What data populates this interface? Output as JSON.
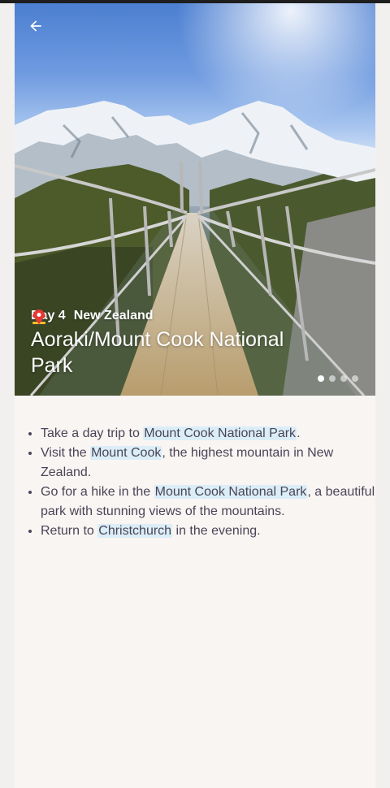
{
  "app": {
    "back_icon": "arrow-back-icon",
    "hero": {
      "day_emoji_icon": "beach-umbrella-icon",
      "day_label": "Day 4",
      "location_emoji_icon": "map-pin-icon",
      "location": "New Zealand",
      "title": "Aoraki/Mount Cook National Park",
      "image_icon": "mountain-bridge-photo",
      "carousel": {
        "count": 4,
        "active_index": 0
      }
    },
    "itinerary": [
      {
        "before": "Take a day trip to ",
        "link": "Mount Cook National Park",
        "after": "."
      },
      {
        "before": "Visit the ",
        "link": "Mount Cook",
        "after": ", the highest mountain in New Zealand."
      },
      {
        "before": "Go for a hike in the ",
        "link": "Mount Cook National Park",
        "after": ", a beautiful park with stunning views of the mountains."
      },
      {
        "before": "Return to ",
        "link": "Christchurch",
        "after": " in the evening."
      }
    ],
    "colors": {
      "highlight": "#dbeef7",
      "text": "#4a4458",
      "card_bg": "#f9f5f2"
    }
  }
}
